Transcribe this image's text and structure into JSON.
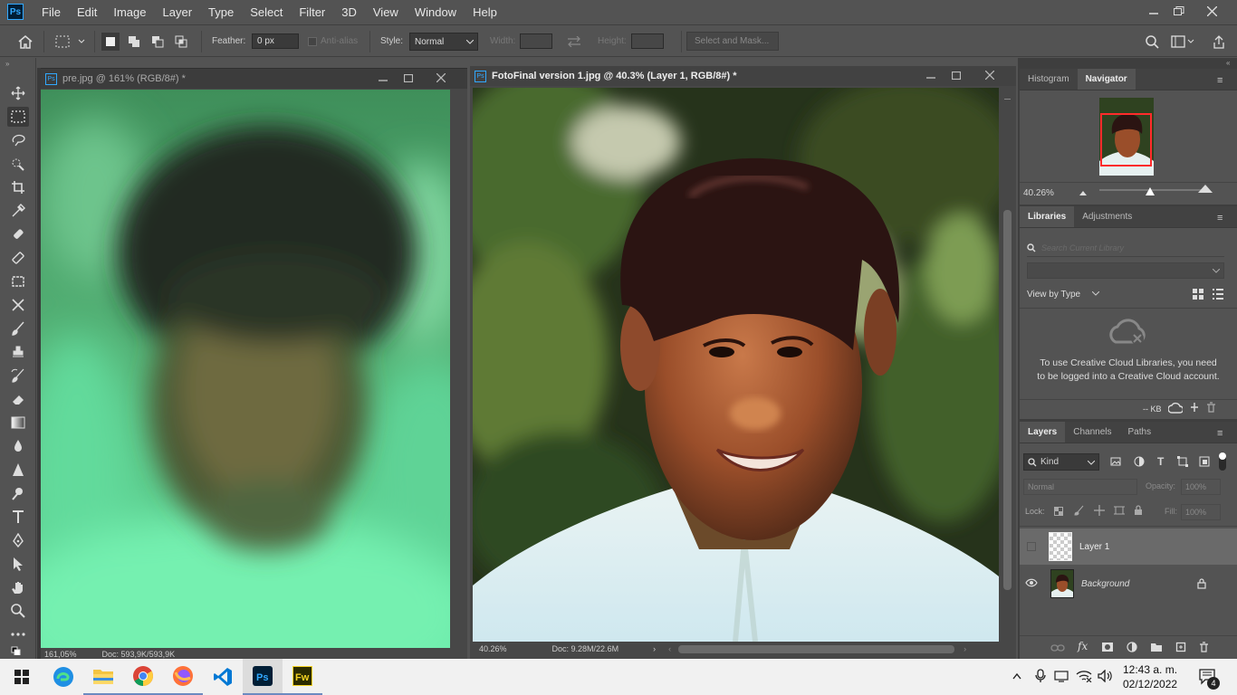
{
  "app": {
    "logo": "Ps"
  },
  "menu": [
    "File",
    "Edit",
    "Image",
    "Layer",
    "Type",
    "Select",
    "Filter",
    "3D",
    "View",
    "Window",
    "Help"
  ],
  "options": {
    "feather_label": "Feather:",
    "feather_value": "0 px",
    "antialias_label": "Anti-alias",
    "style_label": "Style:",
    "style_value": "Normal",
    "width_label": "Width:",
    "height_label": "Height:",
    "select_mask_label": "Select and Mask..."
  },
  "doc1": {
    "title": "pre.jpg @ 161% (RGB/8#) *",
    "zoom": "161,05%",
    "docsize": "Doc: 593,9K/593,9K"
  },
  "doc2": {
    "title": "FotoFinal version 1.jpg @ 40.3% (Layer 1, RGB/8#) *",
    "zoom": "40.26%",
    "docsize": "Doc: 9.28M/22.6M"
  },
  "navigator": {
    "tabs": [
      "Histogram",
      "Navigator"
    ],
    "zoom": "40.26%",
    "zoom_slider": 0.49
  },
  "libraries": {
    "tabs": [
      "Libraries",
      "Adjustments"
    ],
    "search_placeholder": "Search Current Library",
    "view_by": "View by Type",
    "message": "To use Creative Cloud Libraries, you need to be logged into a Creative Cloud account.",
    "kb": "-- KB"
  },
  "layers": {
    "tabs": [
      "Layers",
      "Channels",
      "Paths"
    ],
    "filter_kind": "Kind",
    "blend_mode": "Normal",
    "opacity_label": "Opacity:",
    "opacity_value": "100%",
    "lock_label": "Lock:",
    "fill_label": "Fill:",
    "fill_value": "100%",
    "items": [
      {
        "name": "Layer 1",
        "visible": false,
        "selected": true
      },
      {
        "name": "Background",
        "visible": true,
        "locked": true
      }
    ]
  },
  "taskbar": {
    "time": "12:43 a. m.",
    "date": "02/12/2022",
    "notifications": "4",
    "apps": [
      "edge-icon",
      "file-explorer-icon",
      "chrome-icon",
      "firefox-icon",
      "vscode-icon",
      "photoshop-icon",
      "fireworks-icon"
    ]
  },
  "colors": {
    "accent": "#31a8ff",
    "nav_box": "#ff2b2b"
  }
}
